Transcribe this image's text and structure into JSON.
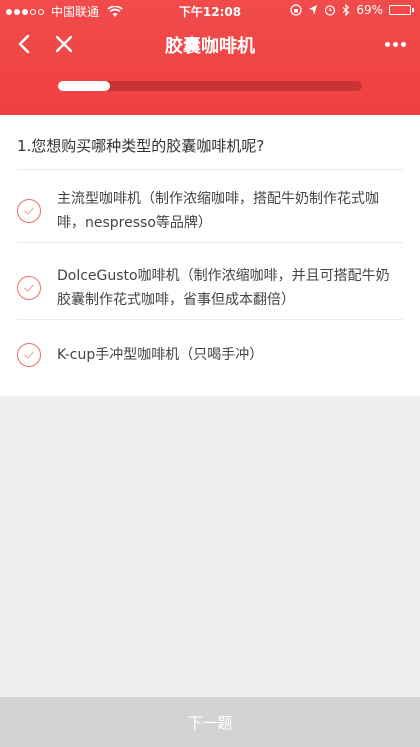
{
  "status_bar": {
    "carrier": "中国联通",
    "time": "下午12:08",
    "battery": "69%",
    "battery_level": 0.69
  },
  "nav": {
    "title": "胶囊咖啡机",
    "back_icon": "chevron-left-icon",
    "close_icon": "close-icon",
    "more_icon": "more-dots-icon"
  },
  "progress": {
    "value": 0.17
  },
  "question": "1.您想购买哪种类型的胶囊咖啡机呢?",
  "options": [
    {
      "label": "主流型咖啡机（制作浓缩咖啡，搭配牛奶制作花式咖啡，nespresso等品牌）"
    },
    {
      "label": "DolceGusto咖啡机（制作浓缩咖啡，并且可搭配牛奶胶囊制作花式咖啡，省事但成本翻倍）"
    },
    {
      "label": "K-cup手冲型咖啡机（只喝手冲）"
    }
  ],
  "footer": {
    "next_label": "下一题"
  },
  "colors": {
    "accent": "#ef4040",
    "footer": "#d3d3d3"
  }
}
